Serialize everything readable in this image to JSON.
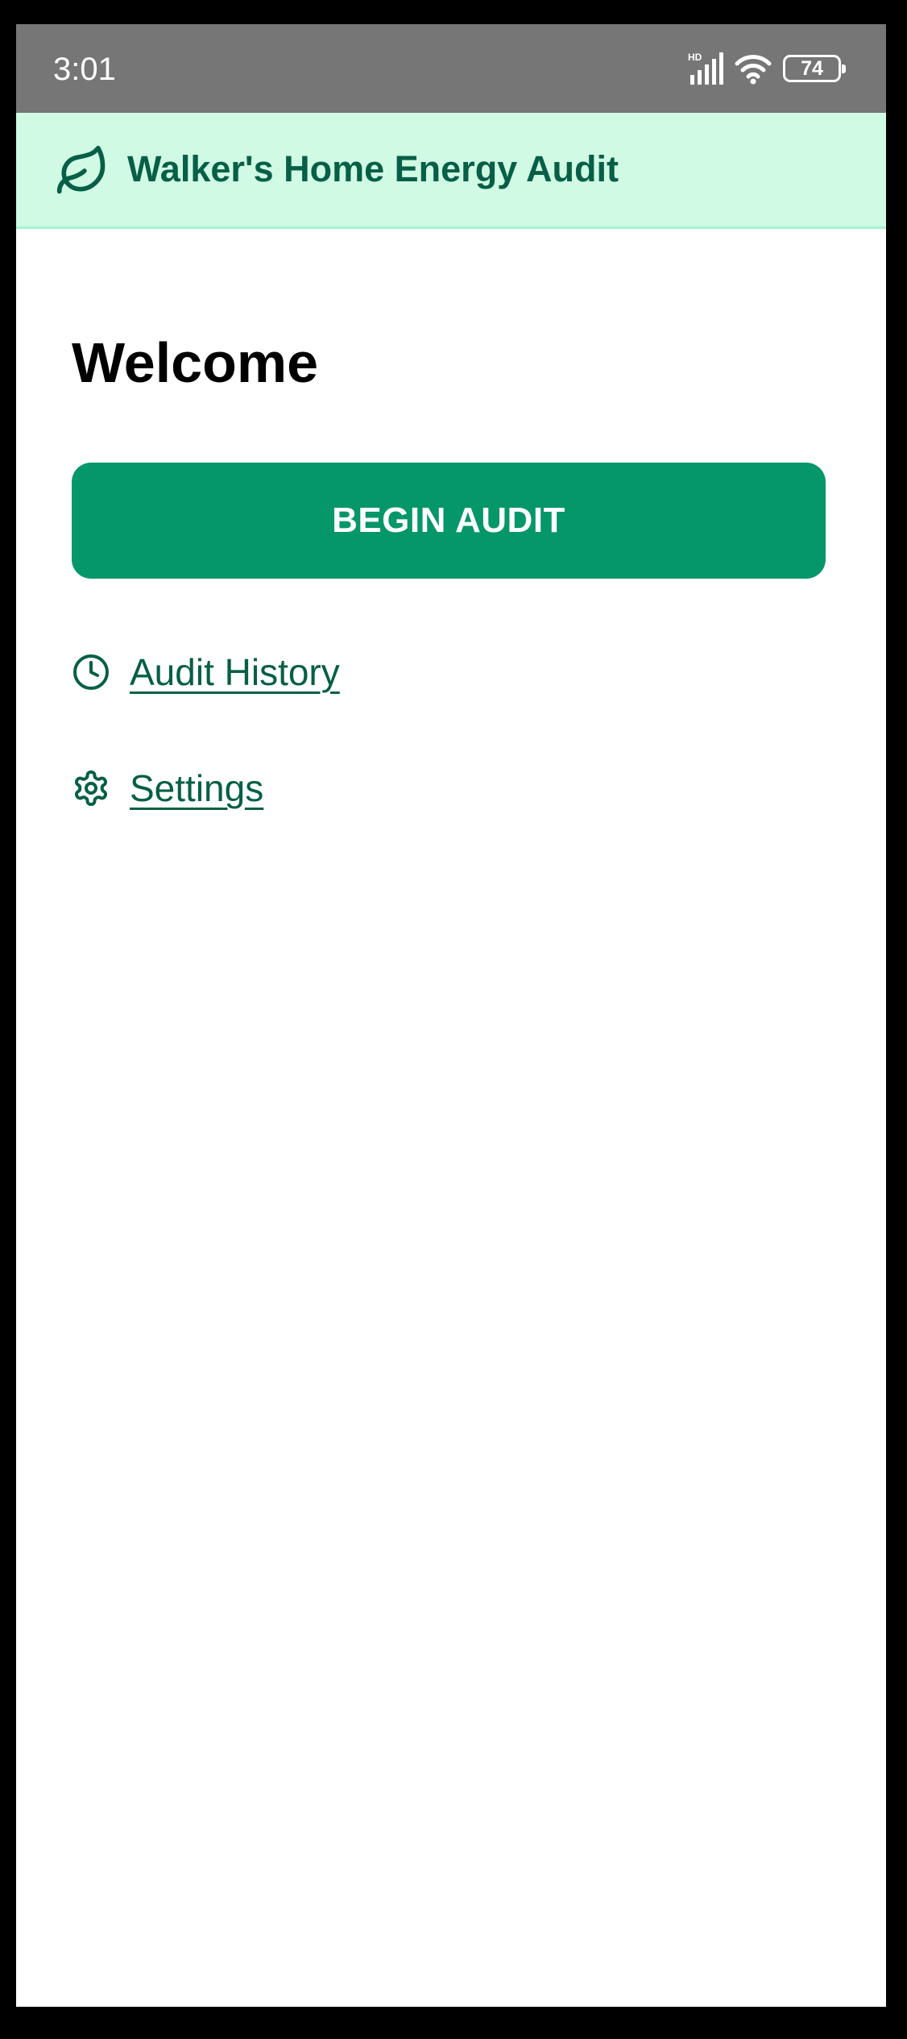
{
  "status_bar": {
    "time": "3:01",
    "network_badge": "HD",
    "battery_level": "74",
    "icons": [
      "signal-icon",
      "wifi-icon",
      "battery-icon"
    ]
  },
  "header": {
    "title": "Walker's Home Energy Audit",
    "icon": "leaf-icon",
    "background_color": "#d1fae5",
    "text_color": "#065f46"
  },
  "main": {
    "heading": "Welcome",
    "primary_button": {
      "label": "BEGIN AUDIT",
      "color": "#059669"
    },
    "links": [
      {
        "label": "Audit History",
        "icon": "clock-icon"
      },
      {
        "label": "Settings",
        "icon": "gear-icon"
      }
    ]
  }
}
